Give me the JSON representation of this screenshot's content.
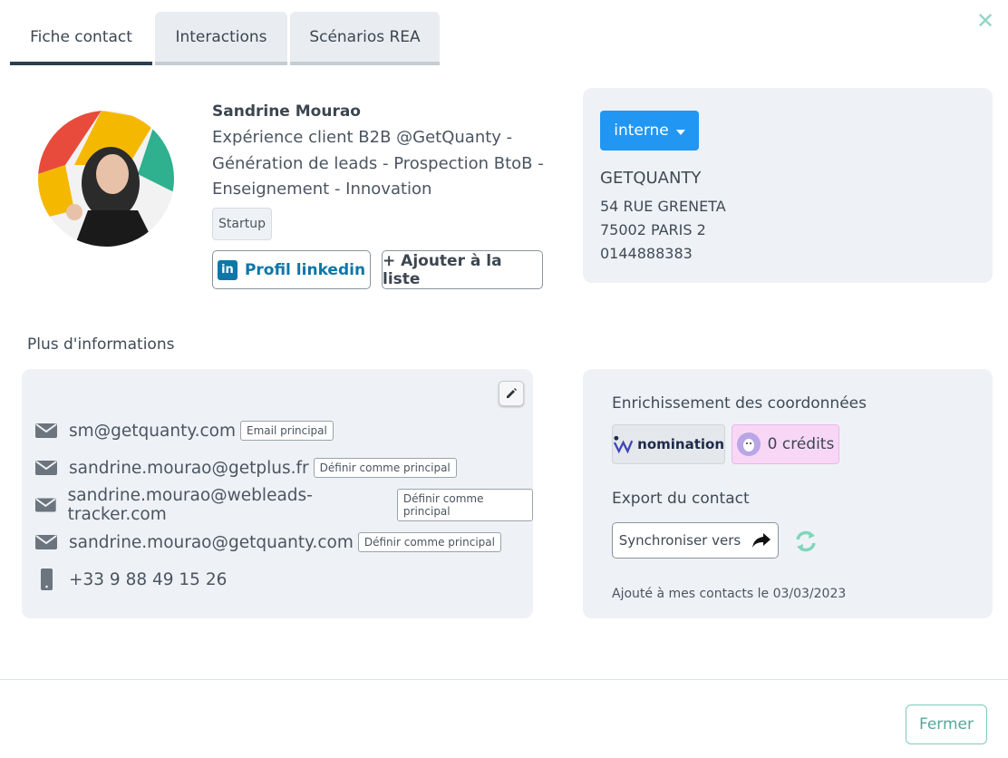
{
  "tabs": [
    {
      "label": "Fiche contact",
      "active": true
    },
    {
      "label": "Interactions",
      "active": false
    },
    {
      "label": "Scénarios REA",
      "active": false
    }
  ],
  "close_icon": "close-icon",
  "profile": {
    "name": "Sandrine Mourao",
    "headline": "Expérience client B2B @GetQuanty - Génération de leads - Prospection BtoB - Enseignement - Innovation",
    "tag": "Startup",
    "linkedin_label": "Profil linkedin",
    "add_list_label": "+ Ajouter à la liste"
  },
  "company": {
    "status": "interne",
    "name": "GETQUANTY",
    "street": "54 RUE GRENETA",
    "city": "75002 PARIS 2",
    "phone": "0144888383"
  },
  "more_info": {
    "title": "Plus d'informations",
    "contacts": [
      {
        "type": "email",
        "value": "sm@getquanty.com",
        "badge": "Email principal"
      },
      {
        "type": "email",
        "value": "sandrine.mourao@getplus.fr",
        "badge": "Définir comme principal"
      },
      {
        "type": "email",
        "value": "sandrine.mourao@webleads-tracker.com",
        "badge": "Définir comme principal"
      },
      {
        "type": "email",
        "value": "sandrine.mourao@getquanty.com",
        "badge": "Définir comme principal"
      },
      {
        "type": "phone",
        "value": "+33 9 88 49 15 26"
      }
    ]
  },
  "enrichment": {
    "title": "Enrichissement des coordonnées",
    "provider": "nomination",
    "credits": "0 crédits",
    "export_title": "Export du contact",
    "sync_label": "Synchroniser vers",
    "added_text": "Ajouté à mes contacts le 03/03/2023"
  },
  "footer": {
    "close_label": "Fermer"
  },
  "colors": {
    "primary_blue": "#2196f3",
    "linkedin": "#0e76a8",
    "teal": "#54a99a",
    "card_bg": "#eef2f6"
  }
}
